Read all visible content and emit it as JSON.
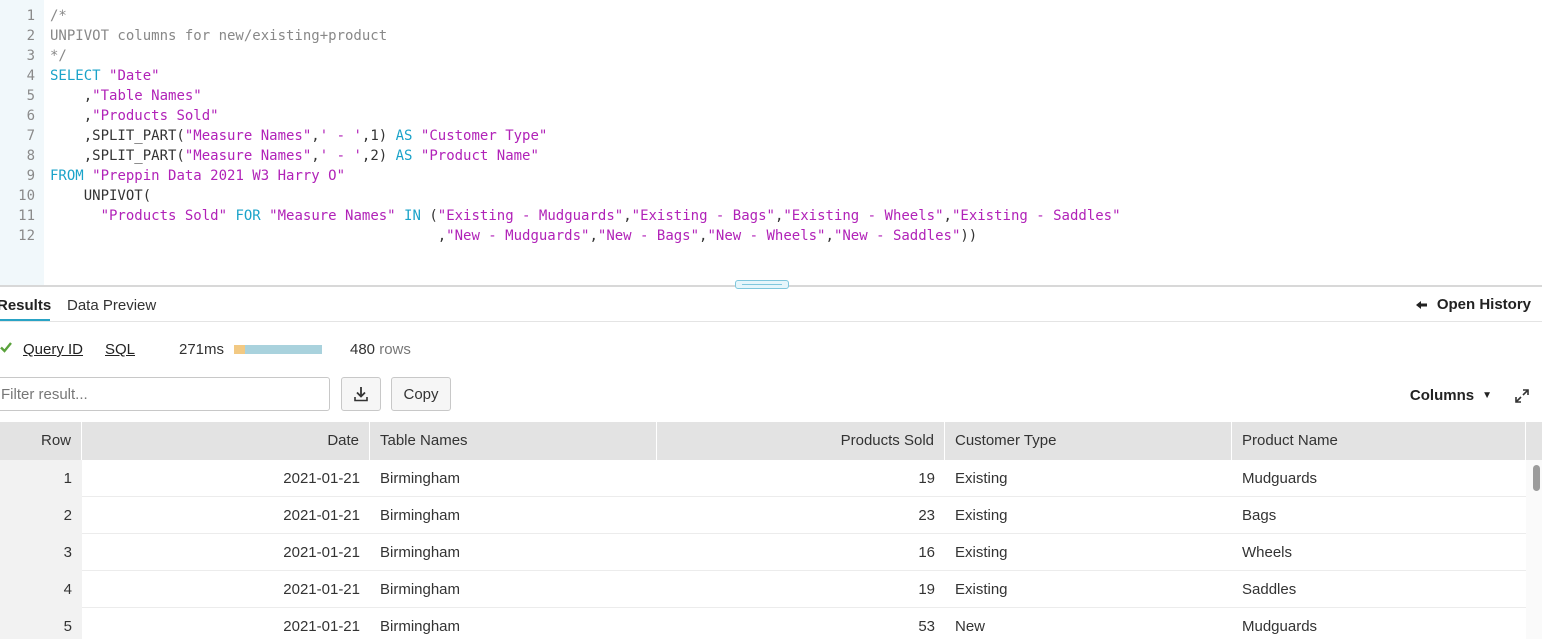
{
  "editor": {
    "lines": [
      {
        "n": "1",
        "tokens": [
          {
            "t": "/*",
            "c": "comment"
          }
        ]
      },
      {
        "n": "2",
        "tokens": [
          {
            "t": "UNPIVOT columns for new/existing+product",
            "c": "comment"
          }
        ]
      },
      {
        "n": "3",
        "tokens": [
          {
            "t": "*/",
            "c": "comment"
          }
        ]
      },
      {
        "n": "4",
        "tokens": [
          {
            "t": "SELECT ",
            "c": "kw"
          },
          {
            "t": "\"Date\"",
            "c": "str"
          }
        ]
      },
      {
        "n": "5",
        "tokens": [
          {
            "t": "    ,",
            "c": "plain"
          },
          {
            "t": "\"Table Names\"",
            "c": "str"
          }
        ]
      },
      {
        "n": "6",
        "tokens": [
          {
            "t": "    ,",
            "c": "plain"
          },
          {
            "t": "\"Products Sold\"",
            "c": "str"
          }
        ]
      },
      {
        "n": "7",
        "tokens": [
          {
            "t": "    ,SPLIT_PART(",
            "c": "plain"
          },
          {
            "t": "\"Measure Names\"",
            "c": "str"
          },
          {
            "t": ",",
            "c": "plain"
          },
          {
            "t": "' - '",
            "c": "str"
          },
          {
            "t": ",1) ",
            "c": "plain"
          },
          {
            "t": "AS ",
            "c": "kw"
          },
          {
            "t": "\"Customer Type\"",
            "c": "str"
          }
        ]
      },
      {
        "n": "8",
        "tokens": [
          {
            "t": "    ,SPLIT_PART(",
            "c": "plain"
          },
          {
            "t": "\"Measure Names\"",
            "c": "str"
          },
          {
            "t": ",",
            "c": "plain"
          },
          {
            "t": "' - '",
            "c": "str"
          },
          {
            "t": ",2) ",
            "c": "plain"
          },
          {
            "t": "AS ",
            "c": "kw"
          },
          {
            "t": "\"Product Name\"",
            "c": "str"
          }
        ]
      },
      {
        "n": "9",
        "tokens": [
          {
            "t": "FROM ",
            "c": "kw"
          },
          {
            "t": "\"Preppin Data 2021 W3 Harry O\"",
            "c": "str"
          }
        ]
      },
      {
        "n": "10",
        "tokens": [
          {
            "t": "    UNPIVOT(",
            "c": "plain"
          }
        ]
      },
      {
        "n": "11",
        "tokens": [
          {
            "t": "      ",
            "c": "plain"
          },
          {
            "t": "\"Products Sold\"",
            "c": "str"
          },
          {
            "t": " FOR ",
            "c": "kw"
          },
          {
            "t": "\"Measure Names\"",
            "c": "str"
          },
          {
            "t": " IN ",
            "c": "kw"
          },
          {
            "t": "(",
            "c": "plain"
          },
          {
            "t": "\"Existing - Mudguards\"",
            "c": "str"
          },
          {
            "t": ",",
            "c": "plain"
          },
          {
            "t": "\"Existing - Bags\"",
            "c": "str"
          },
          {
            "t": ",",
            "c": "plain"
          },
          {
            "t": "\"Existing - Wheels\"",
            "c": "str"
          },
          {
            "t": ",",
            "c": "plain"
          },
          {
            "t": "\"Existing - Saddles\"",
            "c": "str"
          }
        ]
      },
      {
        "n": "12",
        "tokens": [
          {
            "t": "                                              ,",
            "c": "plain"
          },
          {
            "t": "\"New - Mudguards\"",
            "c": "str"
          },
          {
            "t": ",",
            "c": "plain"
          },
          {
            "t": "\"New - Bags\"",
            "c": "str"
          },
          {
            "t": ",",
            "c": "plain"
          },
          {
            "t": "\"New - Wheels\"",
            "c": "str"
          },
          {
            "t": ",",
            "c": "plain"
          },
          {
            "t": "\"New - Saddles\"",
            "c": "str"
          },
          {
            "t": "))",
            "c": "plain"
          }
        ]
      }
    ]
  },
  "tabs": {
    "results": "Results",
    "data_preview": "Data Preview",
    "open_history": "Open History"
  },
  "stats": {
    "query_id": "Query ID",
    "sql": "SQL",
    "duration": "271ms",
    "compile_fraction": 0.13,
    "row_count": "480",
    "rows_label": "rows"
  },
  "toolbar": {
    "filter_placeholder": "Filter result...",
    "copy_label": "Copy",
    "columns_label": "Columns"
  },
  "table": {
    "columns": [
      "Row",
      "Date",
      "Table Names",
      "Products Sold",
      "Customer Type",
      "Product Name"
    ],
    "rows": [
      [
        "1",
        "2021-01-21",
        "Birmingham",
        "19",
        "Existing",
        "Mudguards"
      ],
      [
        "2",
        "2021-01-21",
        "Birmingham",
        "23",
        "Existing",
        "Bags"
      ],
      [
        "3",
        "2021-01-21",
        "Birmingham",
        "16",
        "Existing",
        "Wheels"
      ],
      [
        "4",
        "2021-01-21",
        "Birmingham",
        "19",
        "Existing",
        "Saddles"
      ],
      [
        "5",
        "2021-01-21",
        "Birmingham",
        "53",
        "New",
        "Mudguards"
      ]
    ]
  },
  "colors": {
    "keyword": "#1aa3c9",
    "string": "#b122b8",
    "comment": "#888888",
    "accent": "#29a3c5",
    "success": "#5aa23c"
  }
}
